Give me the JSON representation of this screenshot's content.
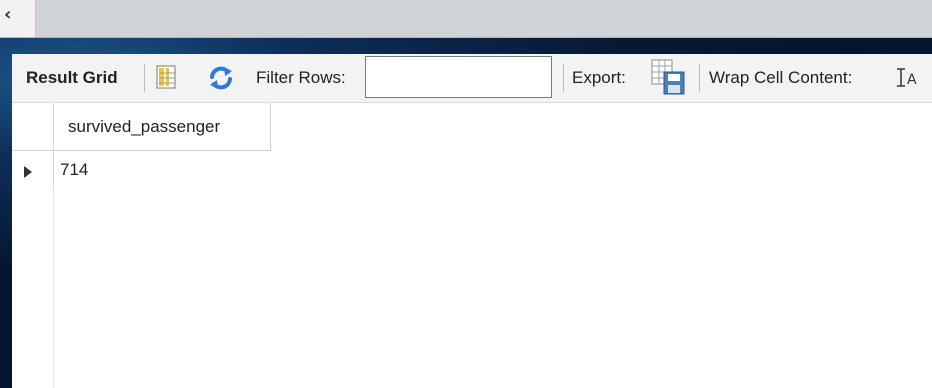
{
  "toolbar": {
    "result_grid_label": "Result Grid",
    "filter_label": "Filter Rows:",
    "filter_value": "",
    "export_label": "Export:",
    "wrap_label": "Wrap Cell Content:"
  },
  "grid": {
    "columns": [
      "survived_passenger"
    ],
    "rows": [
      [
        "714"
      ]
    ]
  },
  "icons": {
    "scroll_left": "chevron-left-icon",
    "form_view": "grid-columns-icon",
    "refresh": "refresh-arrows-icon",
    "export": "export-save-icon",
    "wrap": "wrap-text-icon"
  },
  "colors": {
    "toolbar_bg": "#f3f3f3",
    "panel_bg": "#ffffff",
    "refresh_blue": "#2d7bd6",
    "grid_icon_yellow": "#f2c33d"
  }
}
